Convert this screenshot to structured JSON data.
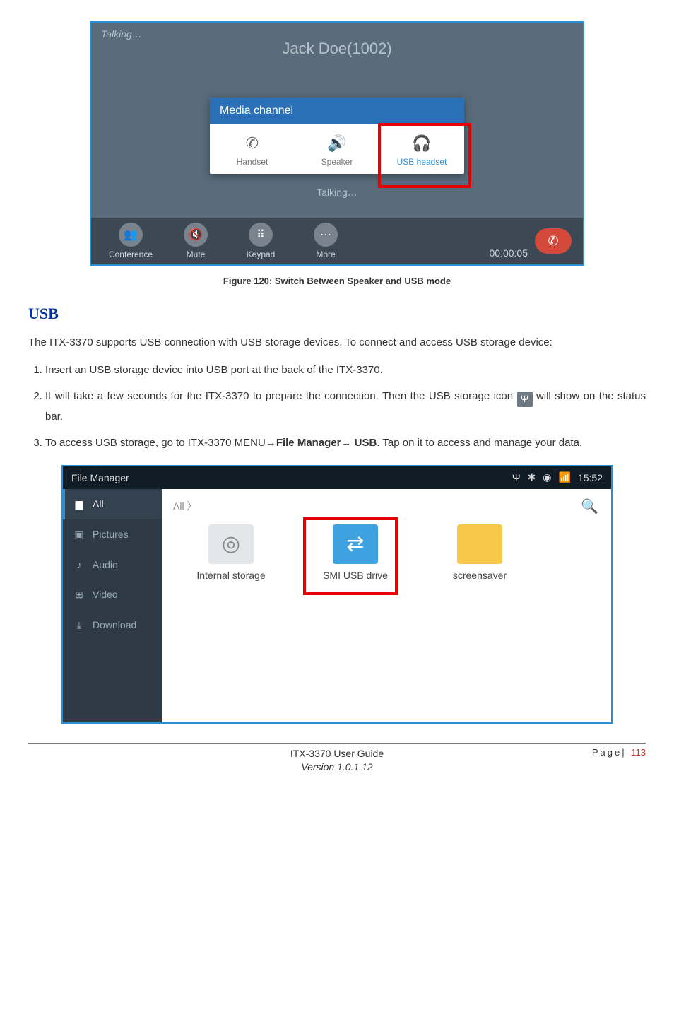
{
  "figure1": {
    "talking_top": "Talking…",
    "caller": "Jack Doe(1002)",
    "popup_title": "Media channel",
    "options": {
      "handset": "Handset",
      "speaker": "Speaker",
      "usbheadset": "USB headset"
    },
    "mid_talking": "Talking…",
    "bottom": {
      "conference": "Conference",
      "mute": "Mute",
      "keypad": "Keypad",
      "more": "More"
    },
    "timer": "00:00:05",
    "caption": "Figure 120: Switch Between Speaker and USB mode"
  },
  "section": {
    "heading": "USB",
    "intro": "The ITX-3370 supports USB connection with USB storage devices. To connect and access USB storage device:",
    "step1": "Insert an USB storage device into USB port at the back of the ITX-3370.",
    "step2a": "It will take a few seconds for the ITX-3370 to prepare the connection. Then the USB storage icon ",
    "step2b": " will show on the status bar.",
    "step3a": "To access USB storage, go to ITX-3370 MENU",
    "step3b": "File Manager",
    "step3c": " USB",
    "step3d": ". Tap on it to access and manage your data."
  },
  "figure2": {
    "title": "File Manager",
    "time": "15:52",
    "side": {
      "all": "All",
      "pictures": "Pictures",
      "audio": "Audio",
      "video": "Video",
      "download": "Download"
    },
    "breadcrumb": "All  〉",
    "items": {
      "internal": "Internal storage",
      "usb": "SMI USB drive",
      "screensaver": "screensaver"
    }
  },
  "footer": {
    "guide": "ITX-3370 User Guide",
    "version": "Version 1.0.1.12",
    "page_label": "Page|",
    "page_num": "113"
  }
}
